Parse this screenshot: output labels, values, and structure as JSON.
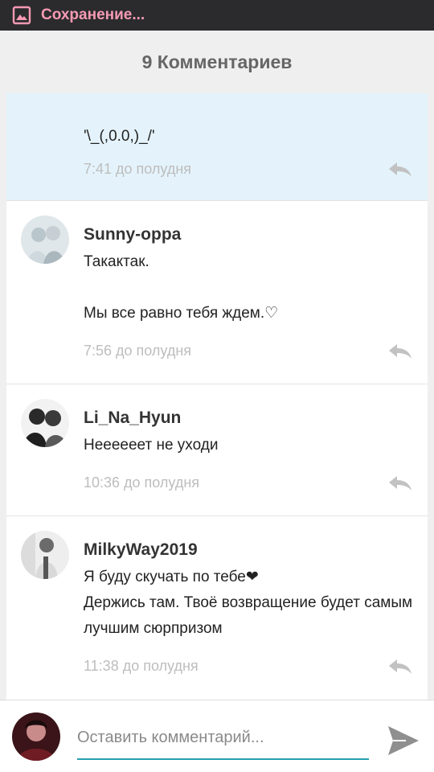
{
  "status_bar": {
    "text": "Сохранение...",
    "icon": "image-icon",
    "accent": "#f59ab4"
  },
  "header": {
    "title": "9 Комментариев"
  },
  "comments": [
    {
      "author": "",
      "text": "'\\_(,0.0,)_/'",
      "time": "7:41 до полудня",
      "highlighted": true
    },
    {
      "author": "Sunny-oppa",
      "text": "Такактак.\n\nМы все равно тебя ждем.♡",
      "time": "7:56 до полудня"
    },
    {
      "author": "Li_Na_Hyun",
      "text": "Неееееет не уходи",
      "time": "10:36 до полудня"
    },
    {
      "author": "MilkyWay2019",
      "text": "Я буду скучать по тебе❤\nДержись там. Твоё возвращение  будет самым лучшим сюрпризом",
      "time": "11:38 до полудня"
    }
  ],
  "composer": {
    "placeholder": "Оставить комментарий...",
    "value": "",
    "send_icon": "send-icon",
    "accent": "#26a0b1"
  }
}
